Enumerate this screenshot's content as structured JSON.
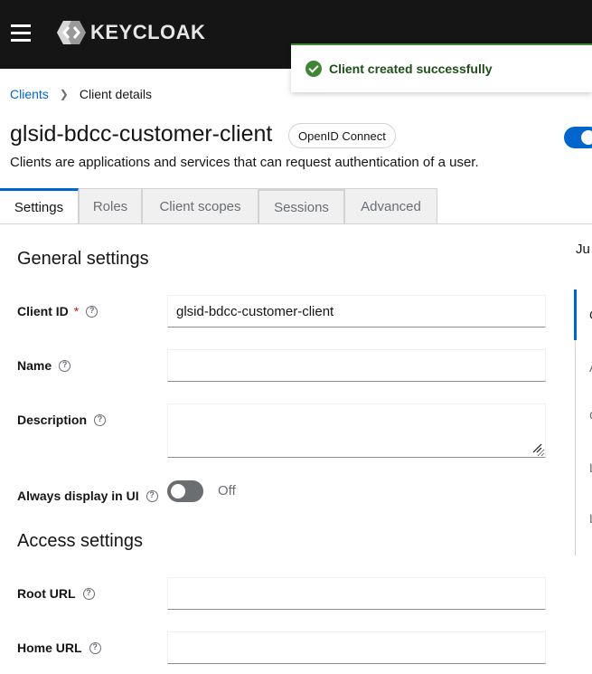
{
  "header": {
    "logo_text": "KEYCLOAK",
    "menu_icon": "hamburger-menu-icon"
  },
  "toast": {
    "title": "Client created successfully",
    "icon": "check-circle-icon",
    "color": "#3e8635"
  },
  "breadcrumb": {
    "items": [
      "Clients",
      "Client details"
    ]
  },
  "client": {
    "title": "glsid-bdcc-customer-client",
    "protocol": "OpenID Connect",
    "subtitle": "Clients are applications and services that can request authentication of a user.",
    "enabled": true
  },
  "tabs": [
    {
      "label": "Settings",
      "active": true
    },
    {
      "label": "Roles"
    },
    {
      "label": "Client scopes"
    },
    {
      "label": "Sessions"
    },
    {
      "label": "Advanced"
    }
  ],
  "general": {
    "heading": "General settings",
    "client_id": {
      "label": "Client ID",
      "required": "*",
      "value": "glsid-bdcc-customer-client"
    },
    "name": {
      "label": "Name",
      "value": ""
    },
    "description": {
      "label": "Description",
      "value": ""
    },
    "always_display": {
      "label": "Always display in UI",
      "state": "Off"
    }
  },
  "access": {
    "heading": "Access settings",
    "root_url": {
      "label": "Root URL",
      "value": ""
    },
    "home_url": {
      "label": "Home URL",
      "value": ""
    }
  },
  "jump_links": {
    "title": "Ju",
    "items": [
      "G",
      "A",
      "C",
      "L",
      "L"
    ]
  },
  "colors": {
    "accent": "#0066cc",
    "masthead": "#151515",
    "success": "#3e8635"
  }
}
